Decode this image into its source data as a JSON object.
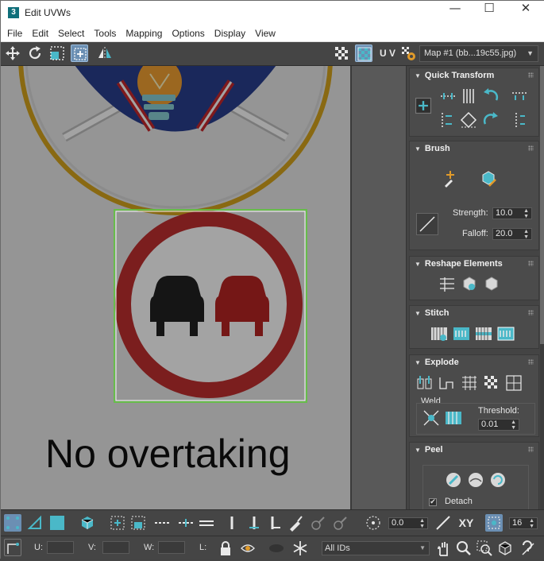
{
  "window": {
    "app_icon": "3",
    "title": "Edit UVWs",
    "minimize": "—",
    "maximize": "☐",
    "close": "✕"
  },
  "menu": [
    "File",
    "Edit",
    "Select",
    "Tools",
    "Mapping",
    "Options",
    "Display",
    "View"
  ],
  "toolbar": {
    "uv_label": "U V",
    "map_select": "Map #1 (bb...19c55.jpg)"
  },
  "viewport": {
    "sign_text": "No overtaking",
    "colors": {
      "ring_red": "#c0302f",
      "car_black": "#222222",
      "car_red": "#b82523",
      "selection_green": "#66cc44"
    }
  },
  "panel": {
    "quick_transform": {
      "title": "Quick Transform"
    },
    "brush": {
      "title": "Brush",
      "strength_label": "Strength:",
      "strength_value": "10.0",
      "falloff_label": "Falloff:",
      "falloff_value": "20.0"
    },
    "reshape": {
      "title": "Reshape Elements"
    },
    "stitch": {
      "title": "Stitch"
    },
    "explode": {
      "title": "Explode",
      "weld_label": "Weld",
      "threshold_label": "Threshold:",
      "threshold_value": "0.01"
    },
    "peel": {
      "title": "Peel",
      "detach_label": "Detach",
      "detach_checked": true
    }
  },
  "bottom": {
    "angle_value": "0.0",
    "xy_label": "XY",
    "pixel_value": "16",
    "u_label": "U:",
    "v_label": "V:",
    "w_label": "W:",
    "l_label": "L:",
    "ids_select": "All IDs"
  },
  "accent": "#4ab8c8"
}
